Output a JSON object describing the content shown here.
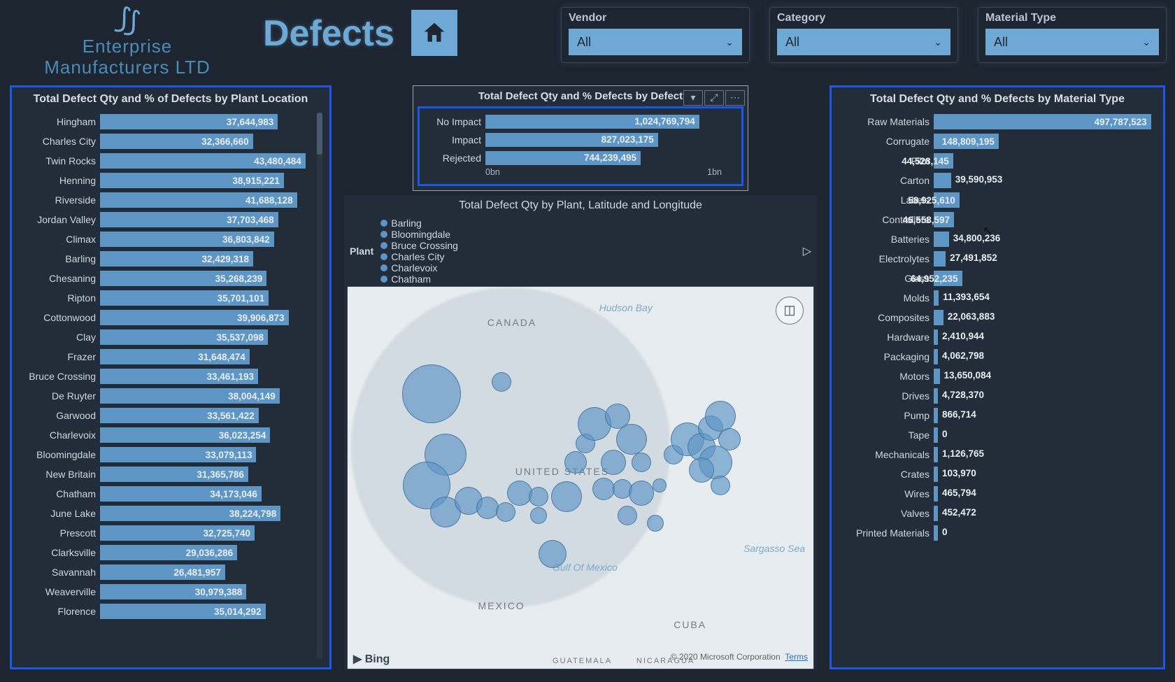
{
  "company_line1": "Enterprise",
  "company_line2": "Manufacturers LTD",
  "page_title": "Defects",
  "filters": [
    {
      "label": "Vendor",
      "value": "All"
    },
    {
      "label": "Category",
      "value": "All"
    },
    {
      "label": "Material Type",
      "value": "All"
    }
  ],
  "plant_panel_title": "Total Defect Qty and % of Defects by Plant Location",
  "defect_panel_title": "Total Defect Qty and % Defects by Defect",
  "material_panel_title": "Total Defect Qty and % Defects by Material Type",
  "map_title": "Total Defect Qty by Plant, Latitude and Longitude",
  "map_legend_label": "Plant",
  "map_legend_items": [
    "Barling",
    "Bloomingdale",
    "Bruce Crossing",
    "Charles City",
    "Charlevoix",
    "Chatham"
  ],
  "map_attrib": "© 2020 Microsoft Corporation",
  "map_terms": "Terms",
  "map_brand": "Bing",
  "map_texts": {
    "canada": "CANADA",
    "us": "UNITED STATES",
    "mexico": "MEXICO",
    "cuba": "CUBA",
    "guatemala": "GUATEMALA",
    "nicaragua": "NICARAGUA",
    "hudson": "Hudson Bay",
    "gulf": "Gulf Of Mexico",
    "sargasso": "Sargasso Sea"
  },
  "axis_ticks": [
    "0bn",
    "1bn"
  ],
  "chart_data": {
    "plant": {
      "type": "bar",
      "title": "Total Defect Qty and % of Defects by Plant Location",
      "max": 45000000,
      "items": [
        {
          "label": "Hingham",
          "value": 37644983,
          "text": "37,644,983"
        },
        {
          "label": "Charles City",
          "value": 32366660,
          "text": "32,366,660"
        },
        {
          "label": "Twin Rocks",
          "value": 43480484,
          "text": "43,480,484"
        },
        {
          "label": "Henning",
          "value": 38915221,
          "text": "38,915,221"
        },
        {
          "label": "Riverside",
          "value": 41688128,
          "text": "41,688,128"
        },
        {
          "label": "Jordan Valley",
          "value": 37703468,
          "text": "37,703,468"
        },
        {
          "label": "Climax",
          "value": 36803842,
          "text": "36,803,842"
        },
        {
          "label": "Barling",
          "value": 32429318,
          "text": "32,429,318"
        },
        {
          "label": "Chesaning",
          "value": 35268239,
          "text": "35,268,239"
        },
        {
          "label": "Ripton",
          "value": 35701101,
          "text": "35,701,101"
        },
        {
          "label": "Cottonwood",
          "value": 39906873,
          "text": "39,906,873"
        },
        {
          "label": "Clay",
          "value": 35537098,
          "text": "35,537,098"
        },
        {
          "label": "Frazer",
          "value": 31648474,
          "text": "31,648,474"
        },
        {
          "label": "Bruce Crossing",
          "value": 33461193,
          "text": "33,461,193"
        },
        {
          "label": "De Ruyter",
          "value": 38004149,
          "text": "38,004,149"
        },
        {
          "label": "Garwood",
          "value": 33561422,
          "text": "33,561,422"
        },
        {
          "label": "Charlevoix",
          "value": 36023254,
          "text": "36,023,254"
        },
        {
          "label": "Bloomingdale",
          "value": 33079113,
          "text": "33,079,113"
        },
        {
          "label": "New Britain",
          "value": 31365786,
          "text": "31,365,786"
        },
        {
          "label": "Chatham",
          "value": 34173046,
          "text": "34,173,046"
        },
        {
          "label": "June Lake",
          "value": 38224798,
          "text": "38,224,798"
        },
        {
          "label": "Prescott",
          "value": 32725740,
          "text": "32,725,740"
        },
        {
          "label": "Clarksville",
          "value": 29036286,
          "text": "29,036,286"
        },
        {
          "label": "Savannah",
          "value": 26481957,
          "text": "26,481,957"
        },
        {
          "label": "Weaverville",
          "value": 30979388,
          "text": "30,979,388"
        },
        {
          "label": "Florence",
          "value": 35014292,
          "text": "35,014,292"
        }
      ]
    },
    "defect": {
      "type": "bar",
      "title": "Total Defect Qty and % Defects by Defect",
      "xlim": [
        0,
        1200000000
      ],
      "items": [
        {
          "label": "No Impact",
          "value": 1024769794,
          "text": "1,024,769,794"
        },
        {
          "label": "Impact",
          "value": 827023175,
          "text": "827,023,175"
        },
        {
          "label": "Rejected",
          "value": 744239495,
          "text": "744,239,495"
        }
      ]
    },
    "material": {
      "type": "bar",
      "title": "Total Defect Qty and % Defects by Material Type",
      "max": 500000000,
      "items": [
        {
          "label": "Raw Materials",
          "value": 497787523,
          "text": "497,787,523"
        },
        {
          "label": "Corrugate",
          "value": 148809195,
          "text": "148,809,195"
        },
        {
          "label": "Film",
          "value": 44528145,
          "text": "44,528,145"
        },
        {
          "label": "Carton",
          "value": 39590953,
          "text": "39,590,953"
        },
        {
          "label": "Labels",
          "value": 58925610,
          "text": "58,925,610"
        },
        {
          "label": "Controllers",
          "value": 46558597,
          "text": "46,558,597"
        },
        {
          "label": "Batteries",
          "value": 34800236,
          "text": "34,800,236"
        },
        {
          "label": "Electrolytes",
          "value": 27491852,
          "text": "27,491,852"
        },
        {
          "label": "Glass",
          "value": 64952235,
          "text": "64,952,235"
        },
        {
          "label": "Molds",
          "value": 11393654,
          "text": "11,393,654"
        },
        {
          "label": "Composites",
          "value": 22063883,
          "text": "22,063,883"
        },
        {
          "label": "Hardware",
          "value": 2410944,
          "text": "2,410,944"
        },
        {
          "label": "Packaging",
          "value": 4062798,
          "text": "4,062,798"
        },
        {
          "label": "Motors",
          "value": 13650084,
          "text": "13,650,084"
        },
        {
          "label": "Drives",
          "value": 4728370,
          "text": "4,728,370"
        },
        {
          "label": "Pump",
          "value": 866714,
          "text": "866,714"
        },
        {
          "label": "Tape",
          "value": 0,
          "text": "0"
        },
        {
          "label": "Mechanicals",
          "value": 1126765,
          "text": "1,126,765"
        },
        {
          "label": "Crates",
          "value": 103970,
          "text": "103,970"
        },
        {
          "label": "Wires",
          "value": 465794,
          "text": "465,794"
        },
        {
          "label": "Valves",
          "value": 452472,
          "text": "452,472"
        },
        {
          "label": "Printed Materials",
          "value": 0,
          "text": "0"
        }
      ]
    },
    "map": {
      "type": "bubble-map",
      "title": "Total Defect Qty by Plant, Latitude and Longitude",
      "bubbles": [
        {
          "x": 18,
          "y": 28,
          "r": 42
        },
        {
          "x": 33,
          "y": 25,
          "r": 14
        },
        {
          "x": 21,
          "y": 44,
          "r": 30
        },
        {
          "x": 17,
          "y": 52,
          "r": 34
        },
        {
          "x": 21,
          "y": 59,
          "r": 22
        },
        {
          "x": 26,
          "y": 56,
          "r": 20
        },
        {
          "x": 30,
          "y": 58,
          "r": 16
        },
        {
          "x": 37,
          "y": 54,
          "r": 18
        },
        {
          "x": 34,
          "y": 59,
          "r": 14
        },
        {
          "x": 41,
          "y": 55,
          "r": 14
        },
        {
          "x": 44,
          "y": 70,
          "r": 20
        },
        {
          "x": 41,
          "y": 60,
          "r": 12
        },
        {
          "x": 47,
          "y": 55,
          "r": 22
        },
        {
          "x": 49,
          "y": 46,
          "r": 16
        },
        {
          "x": 51,
          "y": 41,
          "r": 14
        },
        {
          "x": 53,
          "y": 36,
          "r": 24
        },
        {
          "x": 58,
          "y": 34,
          "r": 18
        },
        {
          "x": 61,
          "y": 40,
          "r": 22
        },
        {
          "x": 57,
          "y": 46,
          "r": 18
        },
        {
          "x": 63,
          "y": 46,
          "r": 14
        },
        {
          "x": 55,
          "y": 53,
          "r": 16
        },
        {
          "x": 59,
          "y": 53,
          "r": 14
        },
        {
          "x": 63,
          "y": 54,
          "r": 18
        },
        {
          "x": 67,
          "y": 52,
          "r": 10
        },
        {
          "x": 60,
          "y": 60,
          "r": 14
        },
        {
          "x": 66,
          "y": 62,
          "r": 12
        },
        {
          "x": 70,
          "y": 44,
          "r": 14
        },
        {
          "x": 73,
          "y": 40,
          "r": 24
        },
        {
          "x": 76,
          "y": 42,
          "r": 20
        },
        {
          "x": 78,
          "y": 37,
          "r": 18
        },
        {
          "x": 80,
          "y": 34,
          "r": 22
        },
        {
          "x": 82,
          "y": 40,
          "r": 16
        },
        {
          "x": 79,
          "y": 46,
          "r": 24
        },
        {
          "x": 76,
          "y": 48,
          "r": 18
        },
        {
          "x": 80,
          "y": 52,
          "r": 14
        }
      ]
    }
  }
}
